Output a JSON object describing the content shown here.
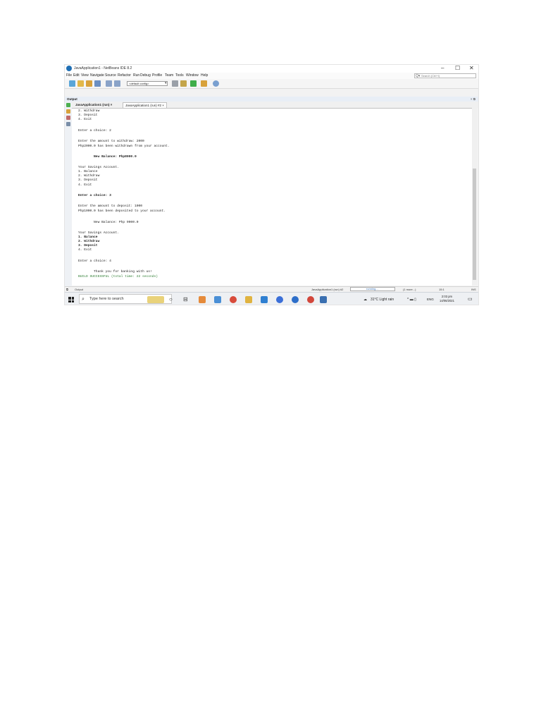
{
  "window": {
    "title": "JavaApplication1 - NetBeans IDE 8.2",
    "controls": [
      "–",
      "☐",
      "✕"
    ]
  },
  "menu": [
    "File",
    "Edit",
    "View",
    "Navigate",
    "Source",
    "Refactor",
    "Run",
    "Debug",
    "Profile",
    "Team",
    "Tools",
    "Window",
    "Help"
  ],
  "search": {
    "placeholder": "Search (Ctrl+I)"
  },
  "toolbar": {
    "config": "<default config>"
  },
  "output_panel": {
    "title": "Output",
    "controls": "× ⧉"
  },
  "tabs": [
    {
      "label": "JavaApplication1 (run) ×"
    },
    {
      "label": "JavaApplication1 (run) #2 ×"
    }
  ],
  "console": {
    "lines": [
      "2. Withdraw",
      "3. Deposit",
      "4. Exit",
      "",
      "Enter a choice: 2",
      "",
      "Enter the amount to withdraw: 2000",
      "Php2000.0 has been withdrawn from your account.",
      "",
      "        New Balance: Php8000.0",
      "",
      "Your Savings Account.",
      "1. Balance",
      "2. Withdraw",
      "3. Deposit",
      "4. Exit",
      "",
      "Enter a choice: 3",
      "",
      "Enter the amount to deposit: 1000",
      "Php1000.0 has been deposited to your account.",
      "",
      "        New Balance: Php 9000.0",
      "",
      "Your Savings Account.",
      "1. Balance",
      "2. Withdraw",
      "3. Deposit",
      "4. Exit",
      "",
      "Enter a choice: 4",
      "",
      "        Thank you for banking with us!",
      "BUILD SUCCESSFUL (total time: 22 seconds)"
    ]
  },
  "statusbar": {
    "output_tab": "Output",
    "run_label": "JavaApplication1 (run) #2",
    "running": "running...",
    "more": "(1 more...)",
    "position": "15:1",
    "ins": "INS"
  },
  "taskbar": {
    "search_placeholder": "Type here to search",
    "weather": "31°C  Light rain",
    "lang": "ENG",
    "time": "2:03 pm",
    "date": "14/06/2021"
  },
  "colors": {
    "build_success": "#2e7d32",
    "title_icon": "#1f6fb5"
  }
}
